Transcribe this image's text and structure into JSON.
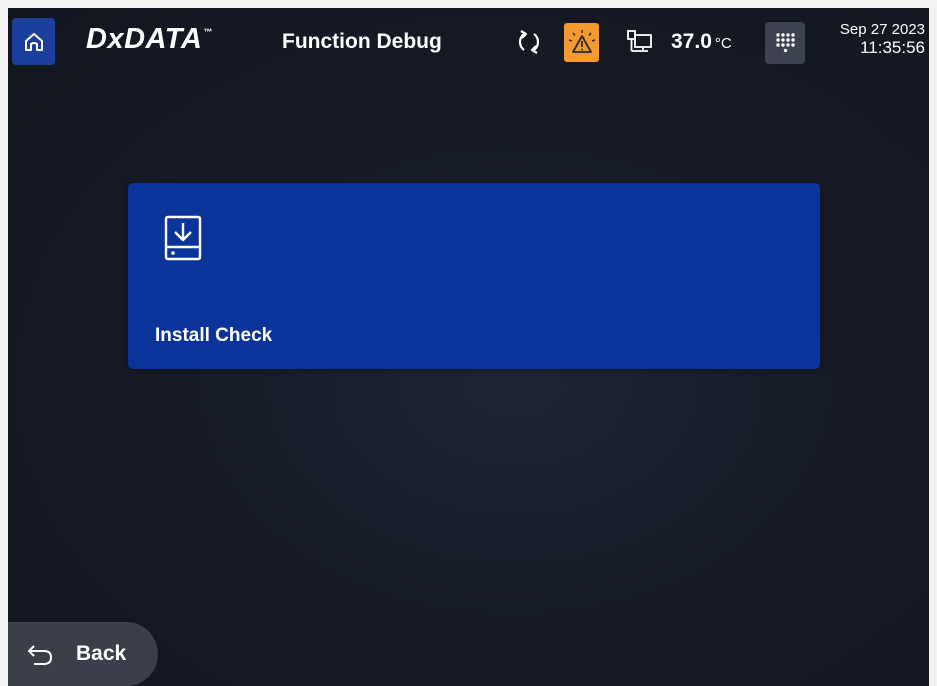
{
  "header": {
    "brand": "DxDATA",
    "brand_tm": "™",
    "title": "Function Debug",
    "temperature": "37.0",
    "temperature_unit": "°C",
    "date": "Sep 27 2023",
    "time": "11:35:56",
    "icons": {
      "home": "home-icon",
      "sync": "sync-icon",
      "alert": "warning-icon",
      "network": "network-icon",
      "keypad": "keypad-icon"
    }
  },
  "main": {
    "cards": [
      {
        "label": "Install Check",
        "icon": "install-download-icon"
      }
    ]
  },
  "footer": {
    "back_label": "Back",
    "back_icon": "back-arrow-icon"
  },
  "colors": {
    "background": "#161b27",
    "home_button": "#1a3f9c",
    "alert_button": "#f59a2f",
    "keypad_button": "#3b4250",
    "card": "#0a3499",
    "back_button": "#3a3f4a",
    "text": "#ffffff"
  }
}
